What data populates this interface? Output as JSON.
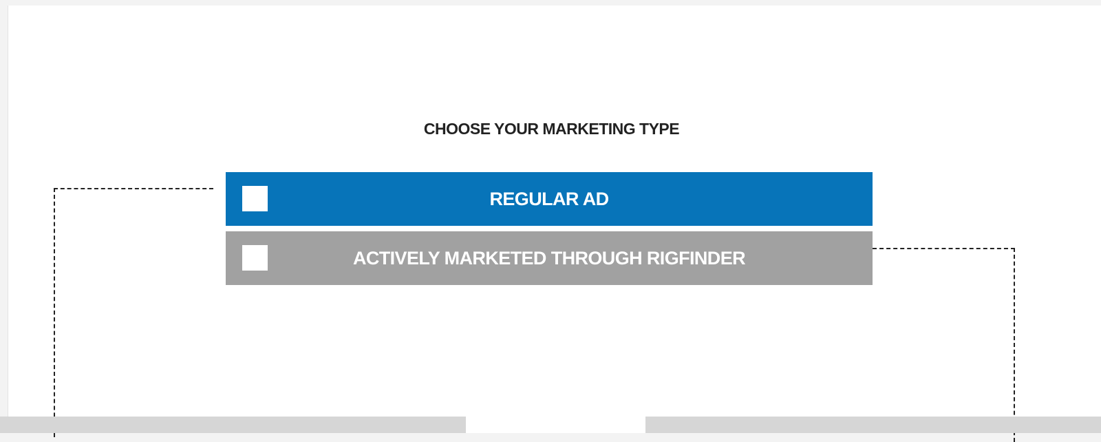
{
  "heading": "CHOOSE YOUR MARKETING TYPE",
  "options": [
    {
      "label": "REGULAR AD",
      "checked": false,
      "color": "#0774b9"
    },
    {
      "label": "ACTIVELY MARKETED THROUGH RIGFINDER",
      "checked": false,
      "color": "#a1a1a1"
    }
  ]
}
